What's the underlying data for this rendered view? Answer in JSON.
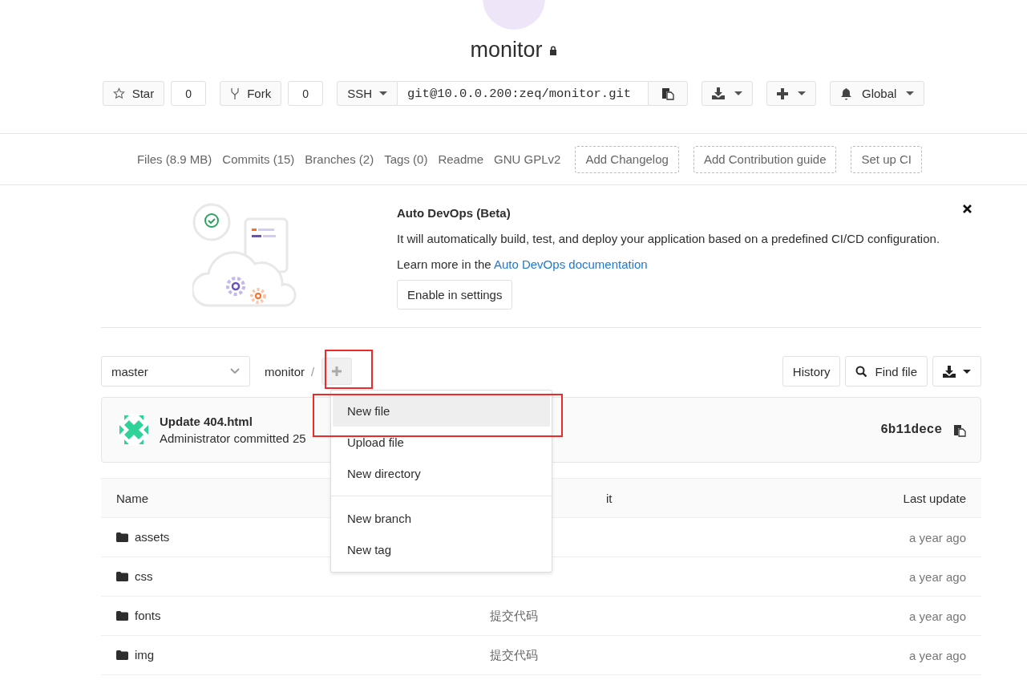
{
  "project": {
    "name": "monitor",
    "private": true
  },
  "actions": [
    {
      "kind": "star",
      "label": "Star",
      "count": "0"
    },
    {
      "kind": "fork",
      "label": "Fork",
      "count": "0"
    }
  ],
  "clone": {
    "protocol": "SSH",
    "url": "git@10.0.0.200:zeq/monitor.git"
  },
  "tool_buttons": [
    {
      "kind": "download"
    },
    {
      "kind": "add"
    }
  ],
  "notification": {
    "label": "Global"
  },
  "nav": {
    "stats": [
      "Files (8.9 MB)",
      "Commits (15)",
      "Branches (2)",
      "Tags (0)",
      "Readme",
      "GNU GPLv2"
    ],
    "dashed_buttons": [
      "Add Changelog",
      "Add Contribution guide",
      "Set up CI"
    ]
  },
  "banner": {
    "title": "Auto DevOps (Beta)",
    "text": "It will automatically build, test, and deploy your application based on a predefined CI/CD configuration.",
    "learn_more": "Learn more in the",
    "link": "Auto DevOps documentation",
    "button": "Enable in settings"
  },
  "tree": {
    "branch": "master",
    "path": "monitor",
    "separator": "/",
    "add_highlighted": true,
    "buttons": [
      "History",
      "Find file"
    ]
  },
  "add_menu": {
    "groups": [
      [
        {
          "label": "New file",
          "hovered": true,
          "highlighted": true
        },
        {
          "label": "Upload file",
          "hovered": false,
          "highlighted": false
        },
        {
          "label": "New directory",
          "hovered": false,
          "highlighted": false
        }
      ],
      [
        {
          "label": "New branch",
          "hovered": false,
          "highlighted": false
        },
        {
          "label": "New tag",
          "hovered": false,
          "highlighted": false
        }
      ]
    ]
  },
  "last_commit": {
    "title": "Update 404.html",
    "meta": "Administrator committed 25",
    "sha": "6b11dece"
  },
  "table": {
    "columns": [
      "Name",
      "it",
      "Last update"
    ],
    "rows": [
      {
        "name": "assets",
        "updated": "a year ago"
      },
      {
        "name": "css",
        "updated": "a year ago"
      },
      {
        "name": "fonts",
        "commit": "提交代码",
        "updated": "a year ago"
      },
      {
        "name": "img",
        "commit": "提交代码",
        "updated": "a year ago"
      }
    ]
  }
}
